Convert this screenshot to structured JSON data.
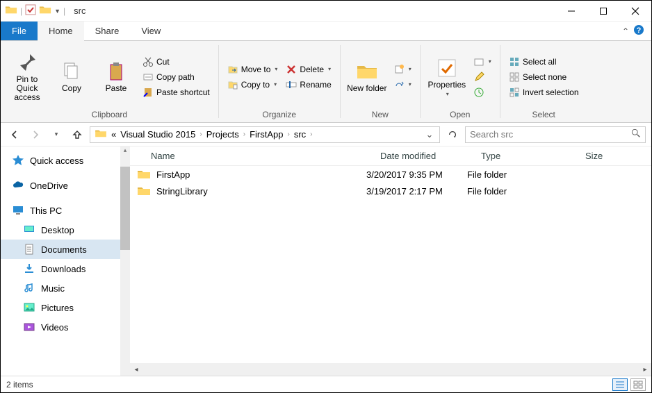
{
  "window": {
    "title": "src"
  },
  "tabs": {
    "file": "File",
    "home": "Home",
    "share": "Share",
    "view": "View"
  },
  "ribbon": {
    "clipboard": {
      "label": "Clipboard",
      "pin": "Pin to Quick access",
      "copy": "Copy",
      "paste": "Paste",
      "cut": "Cut",
      "copy_path": "Copy path",
      "paste_shortcut": "Paste shortcut"
    },
    "organize": {
      "label": "Organize",
      "move_to": "Move to",
      "copy_to": "Copy to",
      "delete": "Delete",
      "rename": "Rename"
    },
    "new": {
      "label": "New",
      "new_folder": "New folder"
    },
    "open": {
      "label": "Open",
      "properties": "Properties"
    },
    "select": {
      "label": "Select",
      "select_all": "Select all",
      "select_none": "Select none",
      "invert": "Invert selection"
    }
  },
  "breadcrumb": {
    "p0": "«",
    "p1": "Visual Studio 2015",
    "p2": "Projects",
    "p3": "FirstApp",
    "p4": "src"
  },
  "search": {
    "placeholder": "Search src"
  },
  "navpane": {
    "quick_access": "Quick access",
    "onedrive": "OneDrive",
    "this_pc": "This PC",
    "desktop": "Desktop",
    "documents": "Documents",
    "downloads": "Downloads",
    "music": "Music",
    "pictures": "Pictures",
    "videos": "Videos"
  },
  "columns": {
    "name": "Name",
    "date": "Date modified",
    "type": "Type",
    "size": "Size"
  },
  "files": [
    {
      "name": "FirstApp",
      "date": "3/20/2017 9:35 PM",
      "type": "File folder"
    },
    {
      "name": "StringLibrary",
      "date": "3/19/2017 2:17 PM",
      "type": "File folder"
    }
  ],
  "status": {
    "items": "2 items"
  }
}
